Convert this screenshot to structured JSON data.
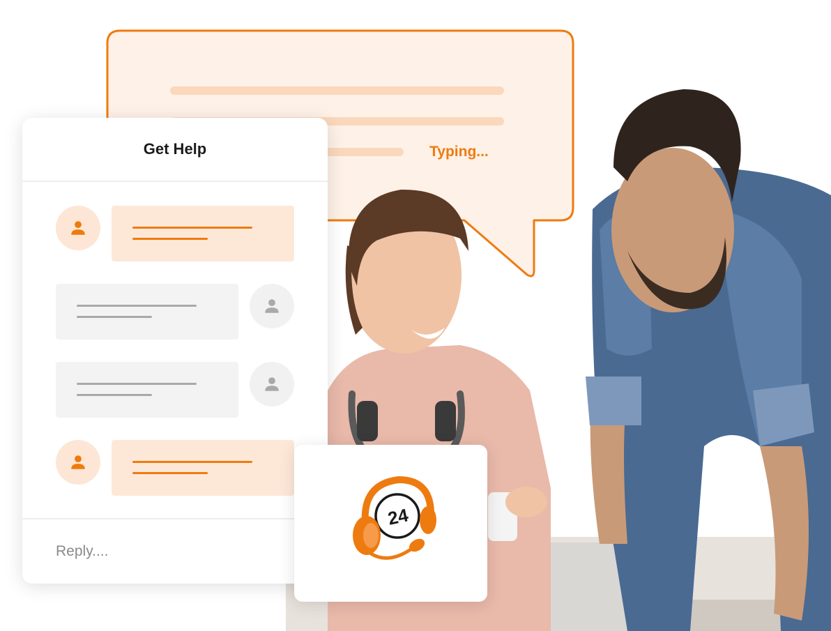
{
  "colors": {
    "accent": "#ee7b0f",
    "accent_light": "#fde8d8",
    "neutral_bubble": "#f3f3f3",
    "neutral_icon": "#a9a9a9"
  },
  "speech_bubble": {
    "status": "Typing..."
  },
  "chat": {
    "title": "Get Help",
    "messages": [
      {
        "sender": "agent",
        "avatar_icon": "person-icon"
      },
      {
        "sender": "user",
        "avatar_icon": "person-icon"
      },
      {
        "sender": "user",
        "avatar_icon": "person-icon"
      },
      {
        "sender": "agent",
        "avatar_icon": "person-icon"
      }
    ],
    "reply_placeholder": "Reply...."
  },
  "support_badge": {
    "number": "24",
    "icon": "headset-icon"
  }
}
